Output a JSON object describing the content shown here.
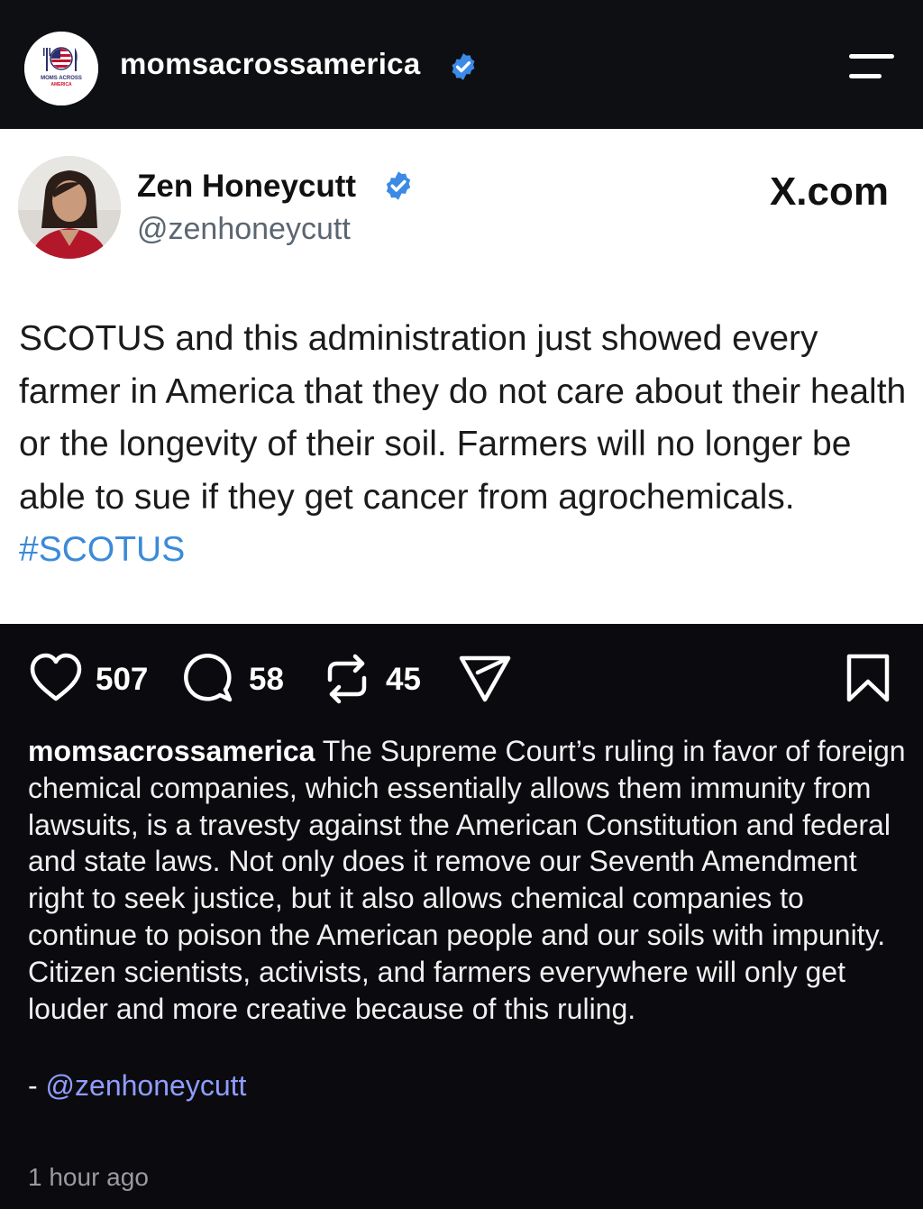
{
  "header": {
    "account_name": "momsacrossamerica",
    "logo_text_top": "MOMS ACROSS",
    "logo_text_bottom": "AMERICA",
    "verified_icon": "verified-badge-icon",
    "menu_icon": "menu-icon"
  },
  "tweet": {
    "name": "Zen Honeycutt",
    "handle": "@zenhoneycutt",
    "source": "X.com",
    "text": "SCOTUS and this administration just showed every farmer in America that they do not care about their health or the longevity of their soil. Farmers will no longer be able to sue if they get cancer from agrochemicals.",
    "hashtag": "#SCOTUS"
  },
  "actions": {
    "likes": "507",
    "comments": "58",
    "reposts": "45",
    "like_icon": "heart-icon",
    "comment_icon": "comment-icon",
    "repost_icon": "repost-icon",
    "share_icon": "send-icon",
    "save_icon": "bookmark-icon"
  },
  "caption": {
    "username": "momsacrossamerica",
    "text": "The Supreme Court’s ruling in favor of foreign chemical companies, which essentially allows them immunity from lawsuits, is a travesty against the American Constitution and federal and state laws. Not only does it remove our Seventh Amendment right to seek justice, but it also allows chemical companies to continue to poison the American people and our soils with impunity. Citizen scientists, activists, and farmers everywhere will only get louder and more creative because of this ruling.",
    "mention_prefix": "- ",
    "mention": "@zenhoneycutt"
  },
  "timestamp": "1 hour ago",
  "colors": {
    "background": "#0b0b0f",
    "verified": "#3b8ae6",
    "hashtag": "#3b8ad9",
    "mention": "#8f9dff"
  }
}
